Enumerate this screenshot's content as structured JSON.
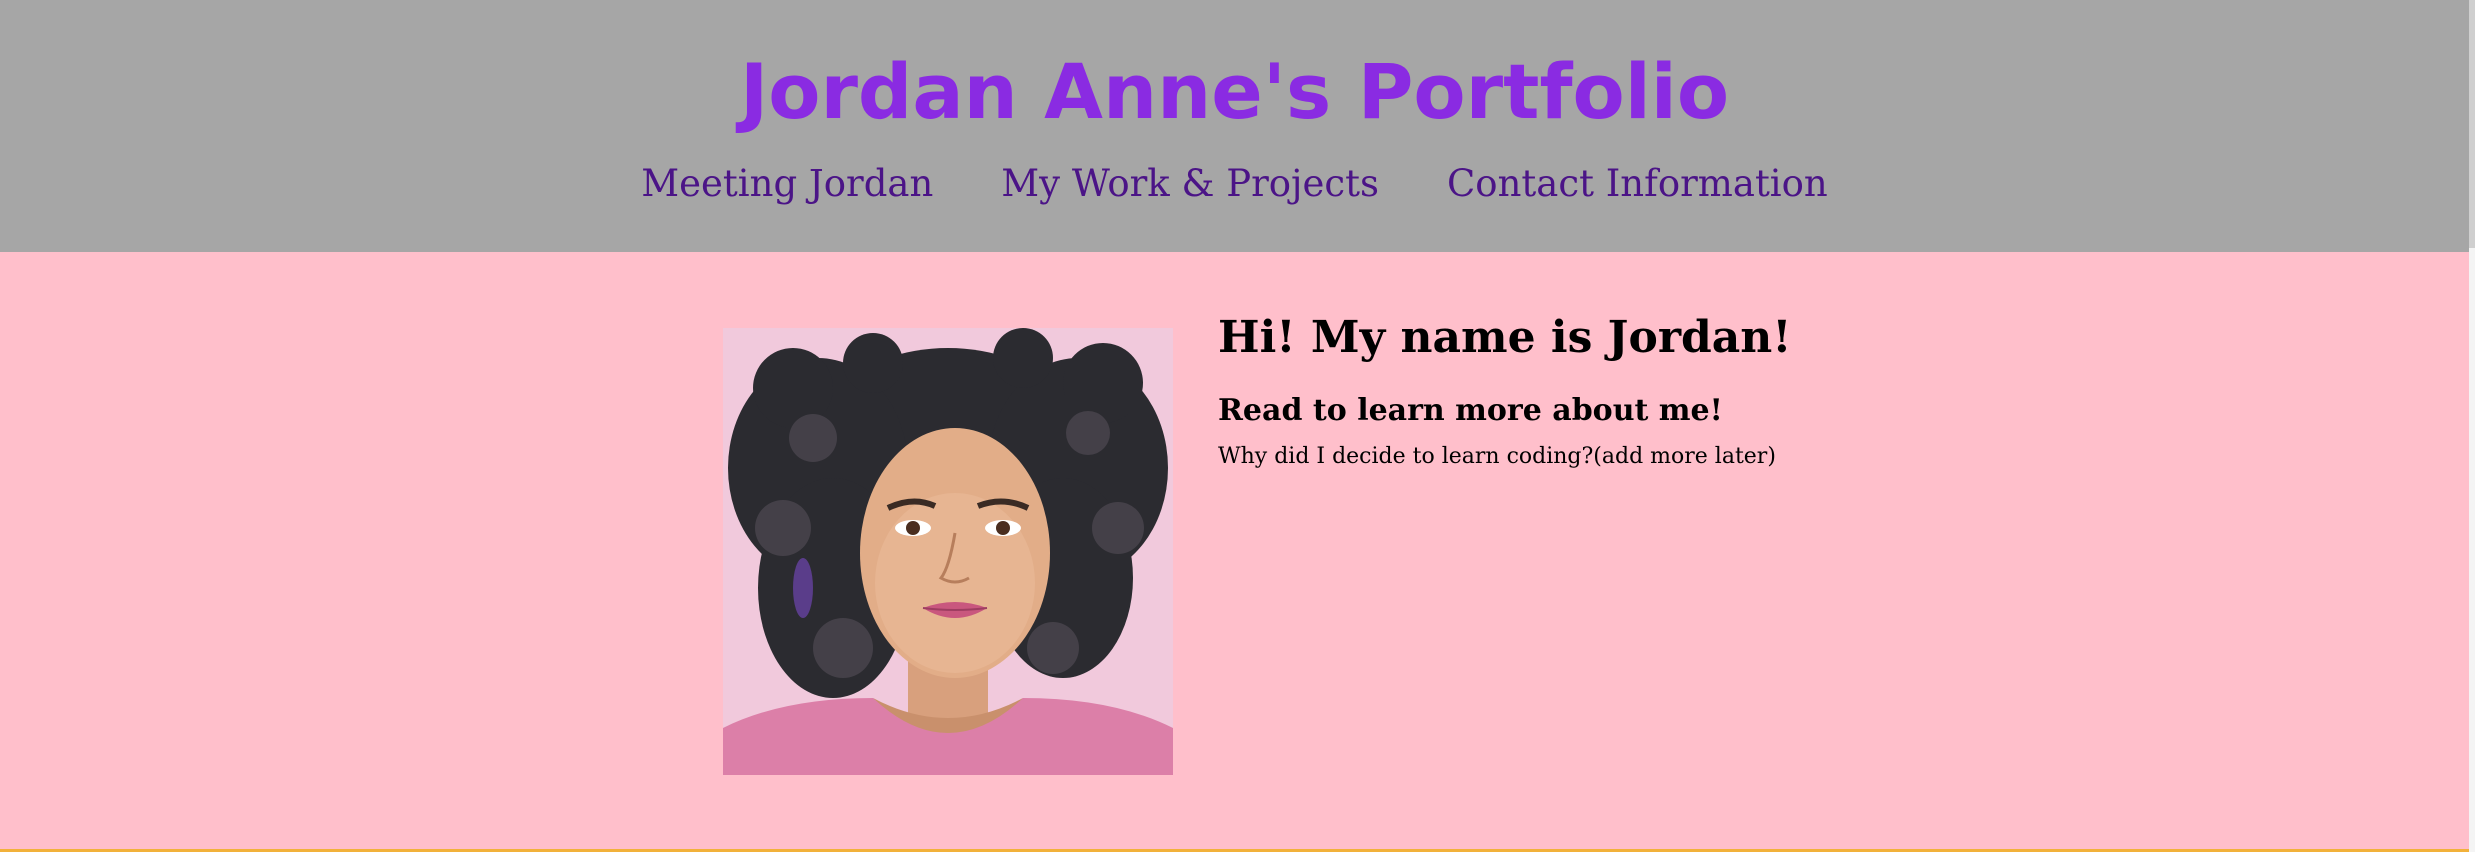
{
  "header": {
    "title": "Jordan Anne's Portfolio",
    "nav": [
      {
        "label": "Meeting Jordan"
      },
      {
        "label": "My Work & Projects"
      },
      {
        "label": "Contact Information"
      }
    ]
  },
  "main": {
    "heading": "Hi! My name is Jordan!",
    "subheading": "Read to learn more about me!",
    "paragraph": "Why did I decide to learn coding?(add more later)"
  },
  "colors": {
    "header_bg": "#a6a6a6",
    "page_bg": "#ffbfcb",
    "title": "#8a2be2",
    "nav_link": "#4b1487"
  }
}
